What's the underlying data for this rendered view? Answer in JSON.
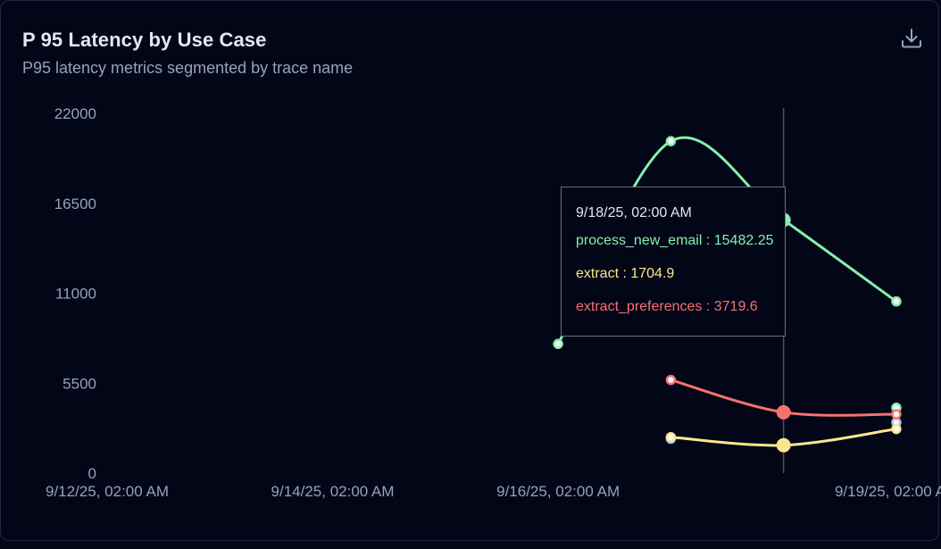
{
  "card": {
    "title": "P 95 Latency by Use Case",
    "subtitle": "P95 latency metrics segmented by trace name",
    "download_icon": "download-icon"
  },
  "colors": {
    "process_new_email": "#86efac",
    "extract": "#fde68a",
    "extract_preferences": "#f87171",
    "other": "#93c5fd",
    "crosshair": "#475569",
    "axis_text": "#94a3b8"
  },
  "chart_data": {
    "type": "line",
    "x_type": "datetime",
    "x_ticks": [
      "9/12/25, 02:00 AM",
      "9/14/25, 02:00 AM",
      "9/16/25, 02:00 AM",
      "9/19/25, 02:00 AM"
    ],
    "xlim": [
      "2025-09-12T02:00",
      "2025-09-19T06:00"
    ],
    "y_ticks": [
      "22000",
      "16500",
      "11000",
      "5500",
      "0"
    ],
    "ylim": [
      0,
      22000
    ],
    "series": [
      {
        "name": "process_new_email",
        "x": [
          "2025-09-16T02:00",
          "2025-09-17T02:00",
          "2025-09-18T02:00",
          "2025-09-19T02:00"
        ],
        "values": [
          7900,
          20300,
          15482.25,
          10500
        ]
      },
      {
        "name": "extract",
        "x": [
          "2025-09-17T02:00",
          "2025-09-18T02:00",
          "2025-09-19T02:00"
        ],
        "values": [
          2200,
          1704.9,
          2700
        ]
      },
      {
        "name": "extract_preferences",
        "x": [
          "2025-09-17T02:00",
          "2025-09-18T02:00",
          "2025-09-19T02:00"
        ],
        "values": [
          5700,
          3719.6,
          3600
        ]
      },
      {
        "name": "",
        "x": [
          "2025-09-17T02:00",
          "2025-09-19T02:00"
        ],
        "values": [
          2100,
          3100
        ]
      },
      {
        "name": "",
        "x": [
          "2025-09-19T02:00"
        ],
        "values": [
          4000
        ]
      }
    ],
    "hover": {
      "x": "2025-09-18T02:00",
      "label": "9/18/25, 02:00 AM",
      "rows": [
        {
          "name": "process_new_email",
          "sep": " : ",
          "value": "15482.25"
        },
        {
          "name": "extract",
          "sep": " : ",
          "value": "1704.9"
        },
        {
          "name": "extract_preferences",
          "sep": " : ",
          "value": "3719.6"
        }
      ]
    }
  }
}
